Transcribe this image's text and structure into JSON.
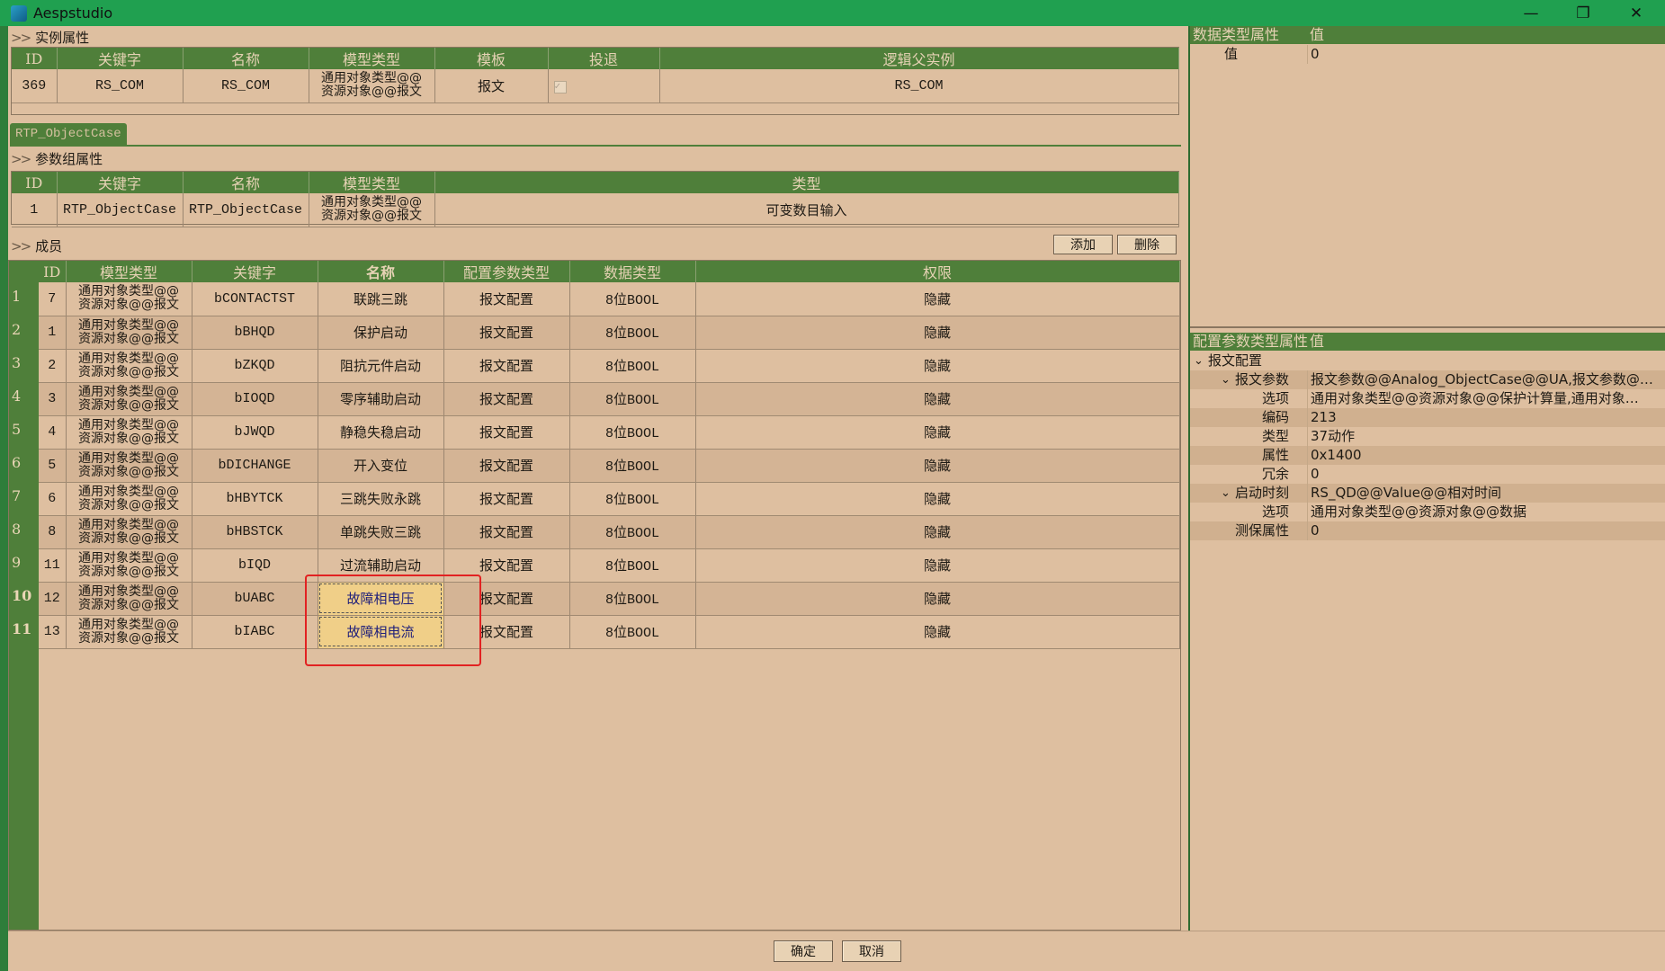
{
  "window": {
    "title": "Aespstudio",
    "minimize": "—",
    "restore": "❐",
    "close": "✕"
  },
  "instance_section": {
    "label": "实例属性",
    "headers": [
      "ID",
      "关键字",
      "名称",
      "模型类型",
      "模板",
      "投退",
      "逻辑父实例"
    ],
    "row": {
      "id": "369",
      "keyword": "RS_COM",
      "name": "RS_COM",
      "model_type_1": "通用对象类型@@",
      "model_type_2": "资源对象@@报文",
      "template": "报文",
      "toggle_checked": true,
      "parent": "RS_COM"
    }
  },
  "tab": {
    "label": "RTP_ObjectCase"
  },
  "param_group_section": {
    "label": "参数组属性",
    "headers": [
      "ID",
      "关键字",
      "名称",
      "模型类型",
      "类型"
    ],
    "row": {
      "id": "1",
      "keyword": "RTP_ObjectCase",
      "name": "RTP_ObjectCase",
      "model_type_1": "通用对象类型@@",
      "model_type_2": "资源对象@@报文",
      "type": "可变数目输入"
    }
  },
  "members_section": {
    "label": "成员",
    "add_button": "添加",
    "delete_button": "删除",
    "headers": [
      "ID",
      "模型类型",
      "关键字",
      "名称",
      "配置参数类型",
      "数据类型",
      "权限"
    ],
    "rows": [
      {
        "num": "1",
        "id": "7",
        "mt1": "通用对象类型@@",
        "mt2": "资源对象@@报文",
        "keyword": "bCONTACTST",
        "name": "联跳三跳",
        "cfg": "报文配置",
        "dtype": "8位BOOL",
        "perm": "隐藏"
      },
      {
        "num": "2",
        "id": "1",
        "mt1": "通用对象类型@@",
        "mt2": "资源对象@@报文",
        "keyword": "bBHQD",
        "name": "保护启动",
        "cfg": "报文配置",
        "dtype": "8位BOOL",
        "perm": "隐藏"
      },
      {
        "num": "3",
        "id": "2",
        "mt1": "通用对象类型@@",
        "mt2": "资源对象@@报文",
        "keyword": "bZKQD",
        "name": "阻抗元件启动",
        "cfg": "报文配置",
        "dtype": "8位BOOL",
        "perm": "隐藏"
      },
      {
        "num": "4",
        "id": "3",
        "mt1": "通用对象类型@@",
        "mt2": "资源对象@@报文",
        "keyword": "bIOQD",
        "name": "零序辅助启动",
        "cfg": "报文配置",
        "dtype": "8位BOOL",
        "perm": "隐藏"
      },
      {
        "num": "5",
        "id": "4",
        "mt1": "通用对象类型@@",
        "mt2": "资源对象@@报文",
        "keyword": "bJWQD",
        "name": "静稳失稳启动",
        "cfg": "报文配置",
        "dtype": "8位BOOL",
        "perm": "隐藏"
      },
      {
        "num": "6",
        "id": "5",
        "mt1": "通用对象类型@@",
        "mt2": "资源对象@@报文",
        "keyword": "bDICHANGE",
        "name": "开入变位",
        "cfg": "报文配置",
        "dtype": "8位BOOL",
        "perm": "隐藏"
      },
      {
        "num": "7",
        "id": "6",
        "mt1": "通用对象类型@@",
        "mt2": "资源对象@@报文",
        "keyword": "bHBYTCK",
        "name": "三跳失败永跳",
        "cfg": "报文配置",
        "dtype": "8位BOOL",
        "perm": "隐藏"
      },
      {
        "num": "8",
        "id": "8",
        "mt1": "通用对象类型@@",
        "mt2": "资源对象@@报文",
        "keyword": "bHBSTCK",
        "name": "单跳失败三跳",
        "cfg": "报文配置",
        "dtype": "8位BOOL",
        "perm": "隐藏"
      },
      {
        "num": "9",
        "id": "11",
        "mt1": "通用对象类型@@",
        "mt2": "资源对象@@报文",
        "keyword": "bIQD",
        "name": "过流辅助启动",
        "cfg": "报文配置",
        "dtype": "8位BOOL",
        "perm": "隐藏"
      },
      {
        "num": "10",
        "id": "12",
        "mt1": "通用对象类型@@",
        "mt2": "资源对象@@报文",
        "keyword": "bUABC",
        "name": "故障相电压",
        "cfg": "报文配置",
        "dtype": "8位BOOL",
        "perm": "隐藏"
      },
      {
        "num": "11",
        "id": "13",
        "mt1": "通用对象类型@@",
        "mt2": "资源对象@@报文",
        "keyword": "bIABC",
        "name": "故障相电流",
        "cfg": "报文配置",
        "dtype": "8位BOOL",
        "perm": "隐藏"
      }
    ]
  },
  "data_type_panel": {
    "headers": [
      "数据类型属性",
      "值"
    ],
    "rows": [
      {
        "key": "值",
        "value": "0"
      }
    ]
  },
  "config_panel": {
    "headers": [
      "配置参数类型属性",
      "值"
    ],
    "rows": [
      {
        "level": 0,
        "expand": "⌄",
        "key": "报文配置",
        "value": ""
      },
      {
        "level": 1,
        "expand": "⌄",
        "key": "报文参数",
        "value": "报文参数@@Analog_ObjectCase@@UA,报文参数@@…"
      },
      {
        "level": 2,
        "expand": "",
        "key": "选项",
        "value": "通用对象类型@@资源对象@@保护计算量,通用对象…"
      },
      {
        "level": 2,
        "expand": "",
        "key": "编码",
        "value": "213"
      },
      {
        "level": 2,
        "expand": "",
        "key": "类型",
        "value": "37动作"
      },
      {
        "level": 2,
        "expand": "",
        "key": "属性",
        "value": "0x1400"
      },
      {
        "level": 2,
        "expand": "",
        "key": "冗余",
        "value": "0"
      },
      {
        "level": 1,
        "expand": "⌄",
        "key": "启动时刻",
        "value": "RS_QD@@Value@@相对时间"
      },
      {
        "level": 2,
        "expand": "",
        "key": "选项",
        "value": "通用对象类型@@资源对象@@数据"
      },
      {
        "level": 1,
        "expand": "",
        "key": "测保属性",
        "value": "0"
      }
    ]
  },
  "footer": {
    "ok_button": "确定",
    "cancel_button": "取消"
  },
  "colors": {
    "accent": "#4f7f3a",
    "titlebar": "#20a050",
    "background": "#debfa0",
    "selected_cell": "#f0cf88",
    "highlight_box": "#e22222"
  }
}
